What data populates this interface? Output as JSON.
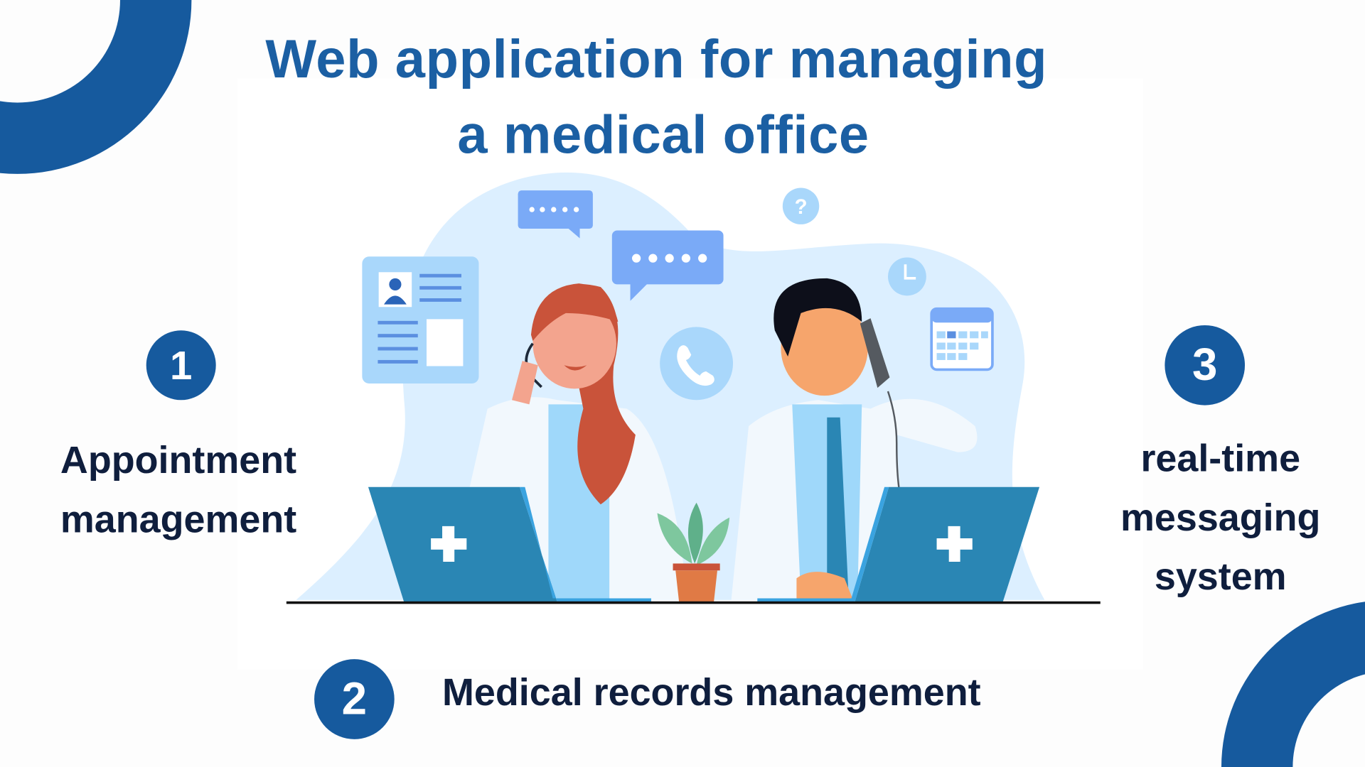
{
  "title": {
    "line1": "Web application for managing",
    "line2": "a medical office"
  },
  "features": [
    {
      "number": "1",
      "line1": "Appointment",
      "line2": "management"
    },
    {
      "number": "2",
      "label": "Medical records management"
    },
    {
      "number": "3",
      "line1": "real-time",
      "line2": "messaging",
      "line3": "system"
    }
  ],
  "colors": {
    "brand": "#165a9e",
    "title": "#1b5fa3",
    "text": "#0f1e3d",
    "laptop": "#2a86b4",
    "light": "#dcefff"
  },
  "illustration": {
    "help_icon_text": "?"
  }
}
